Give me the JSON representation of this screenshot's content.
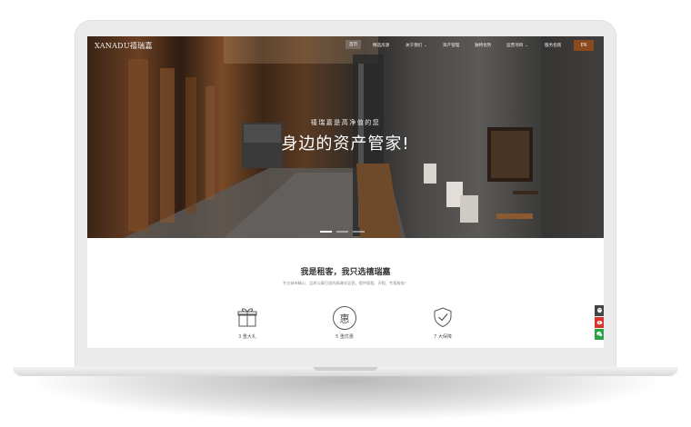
{
  "site": {
    "logo": "XANADU禧瑞嘉"
  },
  "nav": {
    "items": [
      {
        "label": "首页",
        "active": true
      },
      {
        "label": "精选房源",
        "active": false
      },
      {
        "label": "关于我们",
        "active": false,
        "dropdown": true
      },
      {
        "label": "资产管理",
        "active": false
      },
      {
        "label": "独特优势",
        "active": false
      },
      {
        "label": "运营项目",
        "active": false,
        "dropdown": true
      },
      {
        "label": "服务指南",
        "active": false
      }
    ],
    "lang": "EN"
  },
  "hero": {
    "subtitle": "禧瑞嘉是高净值的您",
    "title": "身边的资产管家!",
    "slides": 3,
    "active_slide": 1
  },
  "section": {
    "title": "我是租客，我只选禧瑞嘉",
    "description": "专注城市精心、品质公寓打造的高端式运营，提供租租、开租、专租服务！"
  },
  "features": [
    {
      "label": "3 重大礼",
      "icon": "gift-icon"
    },
    {
      "label": "5 重优惠",
      "icon": "discount-icon",
      "glyph": "惠"
    },
    {
      "label": "7 大保障",
      "icon": "shield-check-icon"
    }
  ],
  "side_buttons": [
    {
      "icon": "qq-icon",
      "color": "#444444"
    },
    {
      "icon": "weibo-icon",
      "color": "#d9342b"
    },
    {
      "icon": "wechat-icon",
      "color": "#2ba245"
    }
  ],
  "colors": {
    "accent": "#8b4a1e",
    "wechat": "#2ba245",
    "weibo": "#d9342b"
  }
}
